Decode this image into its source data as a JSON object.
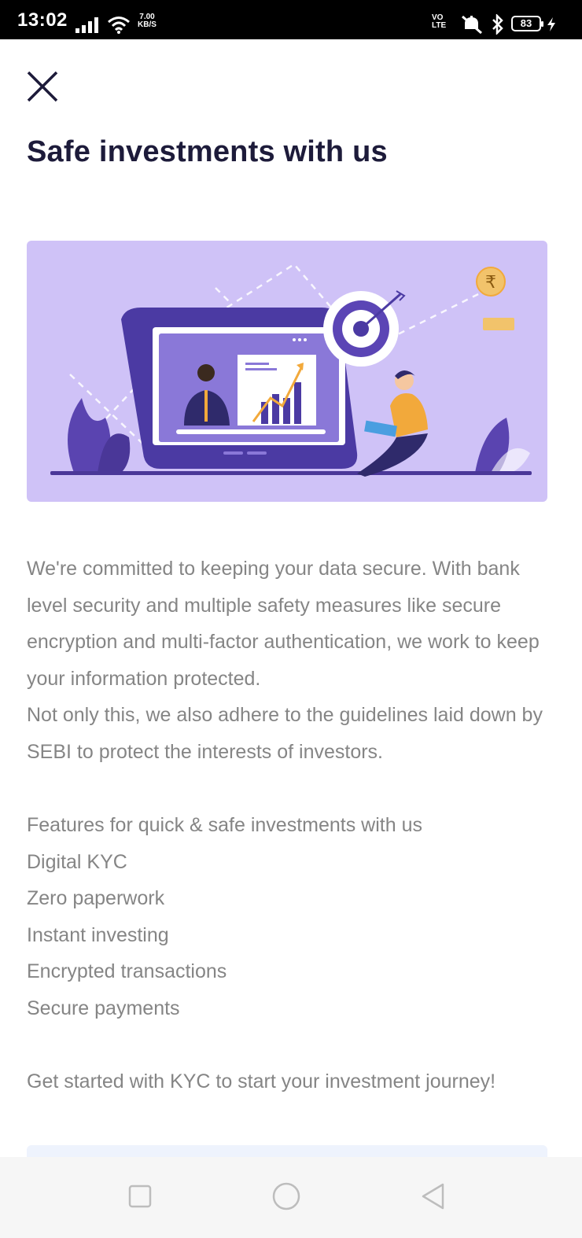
{
  "status_bar": {
    "time": "13:02",
    "net_speed_value": "7.00",
    "net_speed_unit": "KB/S",
    "volte_top": "VO",
    "volte_bottom": "LTE",
    "battery_level": "83",
    "icons": [
      "signal-icon",
      "wifi-icon",
      "volte-icon",
      "mute-icon",
      "bluetooth-icon",
      "battery-icon",
      "charging-icon"
    ]
  },
  "header": {
    "title": "Safe investments with us"
  },
  "hero": {
    "currency_symbol": "₹"
  },
  "content": {
    "paragraph_1": "We're committed to keeping your data secure. With bank level security and multiple safety measures like secure encryption and multi-factor authentication, we work to keep your information protected.",
    "paragraph_2": "Not only this, we also adhere to the guidelines laid down by SEBI to protect the interests of investors.",
    "features_heading": "Features for quick & safe investments with us",
    "features": [
      "Digital KYC",
      "Zero paperwork",
      "Instant investing",
      "Encrypted transactions",
      "Secure payments"
    ],
    "closing": "Get started with KYC to start your investment journey!"
  },
  "colors": {
    "title": "#1d1b3a",
    "body_text": "#858585",
    "hero_bg": "#cfc2f7",
    "accent_purple": "#5b45b5",
    "accent_orange": "#f2a93b"
  }
}
